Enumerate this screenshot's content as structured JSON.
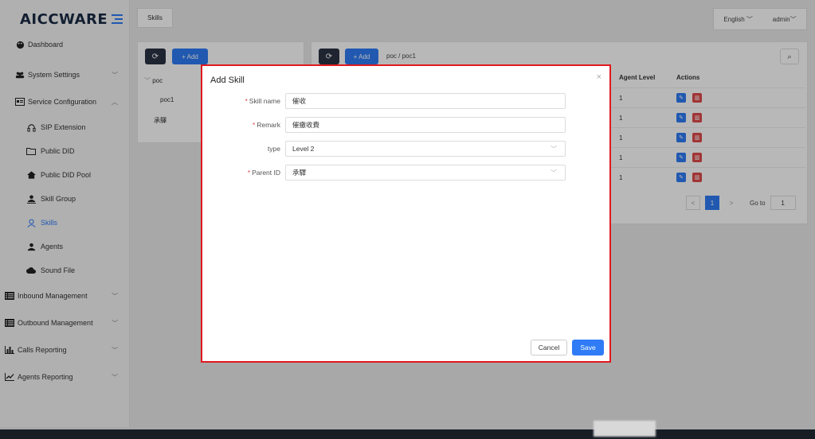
{
  "app": {
    "logo": "AICCWARE",
    "tab_label": "Skills",
    "language": "English",
    "user": "admin"
  },
  "sidebar": {
    "items": [
      {
        "label": "Dashboard",
        "icon": "palette-icon"
      },
      {
        "label": "System Settings",
        "icon": "users-icon",
        "chevron": "﹀"
      },
      {
        "label": "Service Configuration",
        "icon": "id-card-icon",
        "chevron": "︿"
      },
      {
        "label": "SIP Extension",
        "icon": "headset-icon"
      },
      {
        "label": "Public DID",
        "icon": "folder-icon"
      },
      {
        "label": "Public DID Pool",
        "icon": "home-icon"
      },
      {
        "label": "Skill Group",
        "icon": "user-download-icon"
      },
      {
        "label": "Skills",
        "icon": "user-outline-icon"
      },
      {
        "label": "Agents",
        "icon": "user-icon"
      },
      {
        "label": "Sound File",
        "icon": "cloud-icon"
      },
      {
        "label": "Inbound Management",
        "icon": "list-icon",
        "chevron": "﹀"
      },
      {
        "label": "Outbound Management",
        "icon": "list-icon",
        "chevron": "﹀"
      },
      {
        "label": "Calls Reporting",
        "icon": "bar-chart-icon",
        "chevron": "﹀"
      },
      {
        "label": "Agents Reporting",
        "icon": "line-chart-icon",
        "chevron": "﹀"
      }
    ]
  },
  "left_panel": {
    "add_label": "+ Add",
    "tree": [
      {
        "label": "poc",
        "prefix": "﹀"
      },
      {
        "label": "poc1"
      },
      {
        "label": "承驛"
      }
    ]
  },
  "right_panel": {
    "add_label": "+ Add",
    "breadcrumb": "poc / poc1",
    "columns": {
      "agent_level": "Agent Level",
      "actions": "Actions"
    },
    "rows": [
      {
        "agent_level": "1"
      },
      {
        "agent_level": "1"
      },
      {
        "agent_level": "1"
      },
      {
        "agent_level": "1"
      },
      {
        "agent_level": "1"
      }
    ],
    "pagination": {
      "prev": "<",
      "current": "1",
      "next": ">",
      "goto_label": "Go to",
      "goto_value": "1"
    }
  },
  "modal": {
    "title": "Add Skill",
    "close": "×",
    "fields": {
      "skill_name": {
        "label": "Skill name",
        "required": true,
        "value": "催收"
      },
      "remark": {
        "label": "Remark",
        "required": true,
        "value": "催繳收費"
      },
      "type": {
        "label": "type",
        "required": false,
        "value": "Level 2"
      },
      "parent_id": {
        "label": "Parent ID",
        "required": true,
        "value": "承驛"
      }
    },
    "cancel_label": "Cancel",
    "save_label": "Save"
  },
  "colors": {
    "primary": "#2f7cf6",
    "danger": "#e04a4a",
    "dark_button": "#2c3345",
    "highlight_border": "#e0191e"
  }
}
